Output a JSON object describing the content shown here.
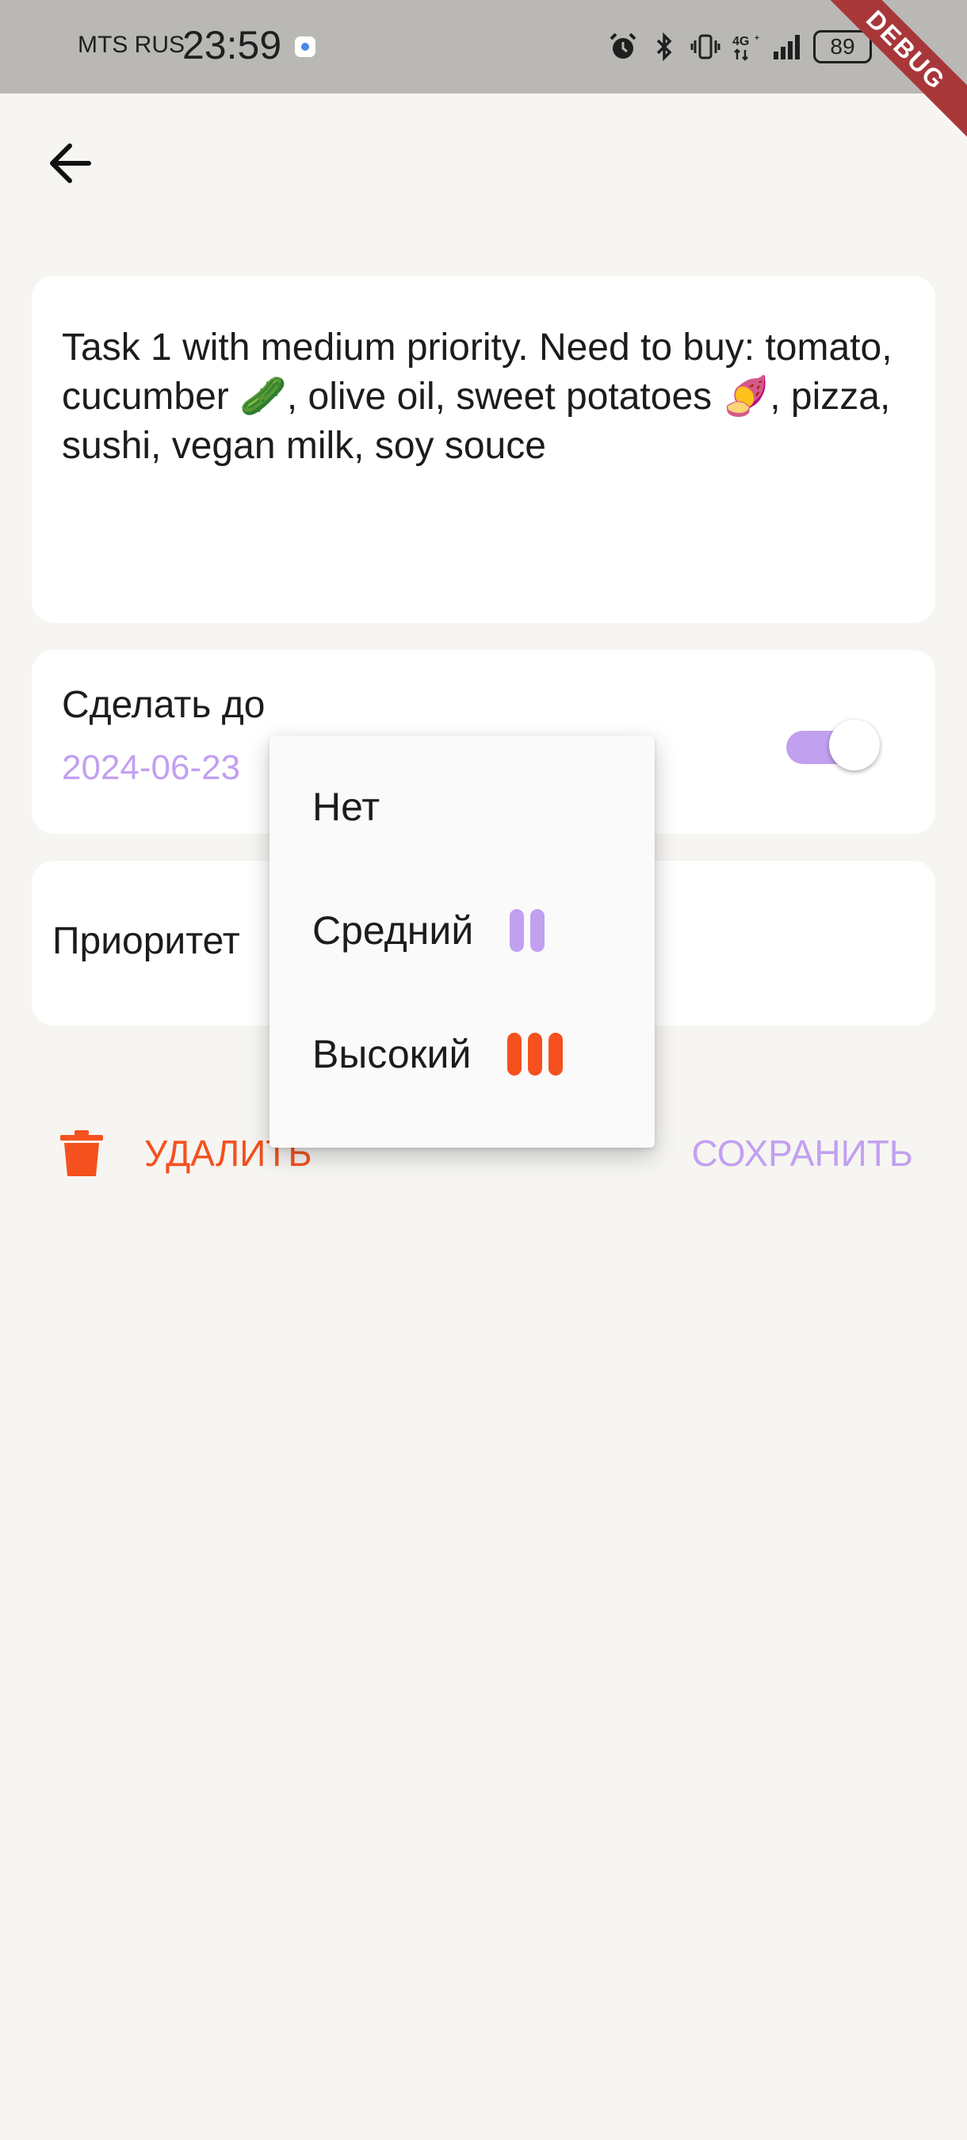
{
  "status_bar": {
    "carrier": "MTS RUS",
    "time": "23:59",
    "battery": "89",
    "icons": [
      "alarm-icon",
      "bluetooth-icon",
      "vibrate-icon",
      "network-4g-icon",
      "signal-icon",
      "battery-icon",
      "charging-icon"
    ]
  },
  "debug_banner": "DEBUG",
  "task": {
    "text": "Task 1 with medium priority. Need to buy: tomato, cucumber 🥒, olive oil, sweet potatoes 🍠, pizza, sushi, vegan milk, soy souce"
  },
  "deadline": {
    "label": "Сделать до",
    "date": "2024-06-23",
    "enabled": true
  },
  "priority": {
    "label": "Приоритет"
  },
  "priority_menu": {
    "items": [
      {
        "label": "Нет",
        "bars": 0,
        "color": ""
      },
      {
        "label": "Средний",
        "bars": 2,
        "color": "#c2a0f0"
      },
      {
        "label": "Высокий",
        "bars": 3,
        "color": "#f4511e"
      }
    ]
  },
  "actions": {
    "delete_label": "УДАЛИТЬ",
    "save_label": "СОХРАНИТЬ"
  },
  "colors": {
    "accent": "#c2a0f0",
    "danger": "#f4511e",
    "background": "#f6f5f2"
  }
}
